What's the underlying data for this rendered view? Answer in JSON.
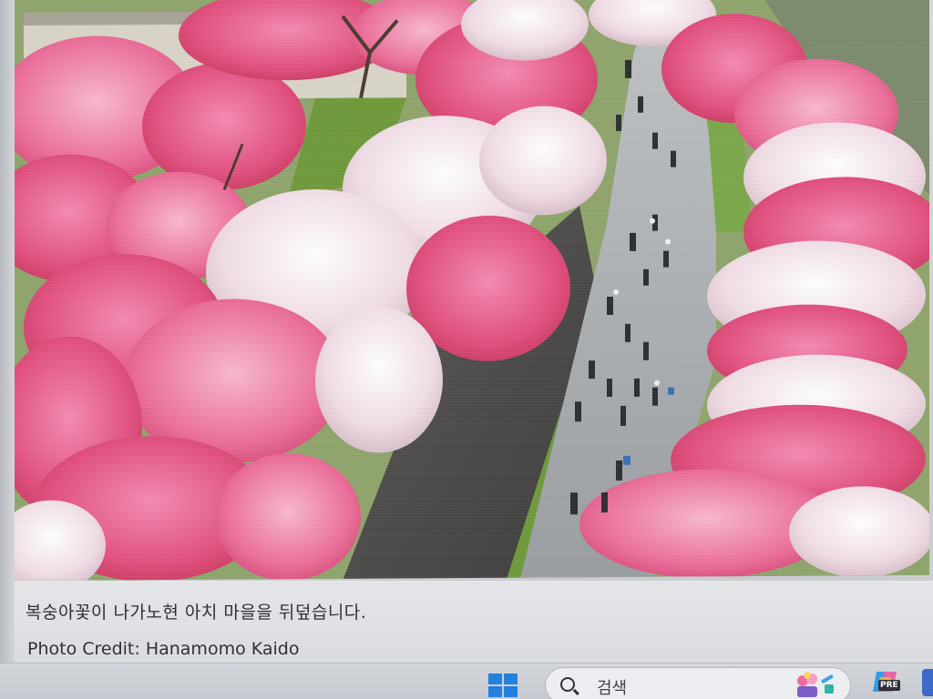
{
  "caption": {
    "text": "복숭아꽃이 나가노현 아치 마을을 뒤덮습니다.",
    "credit": "Photo Credit: Hanamomo Kaido"
  },
  "photo": {
    "subject": "peach-blossom-trees-path",
    "blossom_colors": [
      "#e8578d",
      "#f07aa8",
      "#f5d9e4",
      "#ffffff",
      "#d9406f"
    ]
  },
  "taskbar": {
    "search_placeholder": "검색",
    "start_icon": "windows-logo-icon",
    "search_icon": "search-icon",
    "search_highlight_icon": "flower-pot-icon",
    "copilot_icon": "copilot-icon",
    "copilot_badge": "PRE"
  }
}
